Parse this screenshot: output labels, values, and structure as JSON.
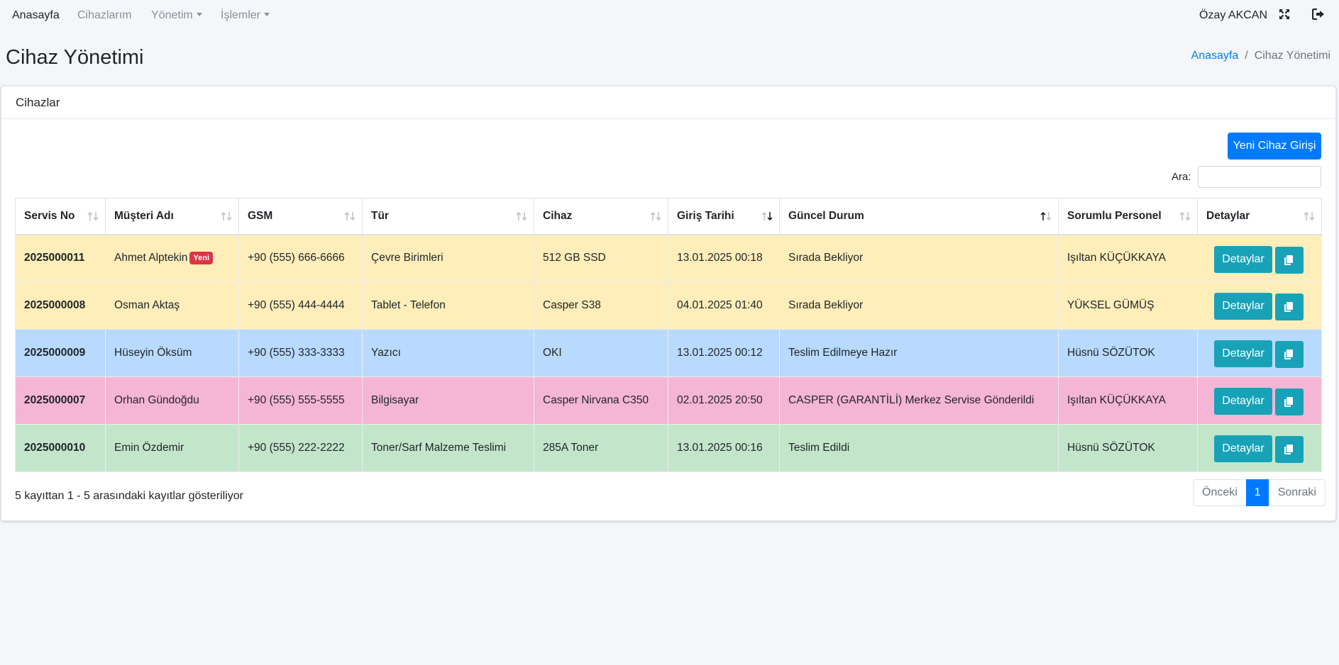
{
  "nav": {
    "home": "Anasayfa",
    "devices": "Cihazlarım",
    "management": "Yönetim",
    "operations": "İşlemler",
    "user": "Özay AKCAN"
  },
  "header": {
    "title": "Cihaz Yönetimi",
    "breadcrumb_home": "Anasayfa",
    "breadcrumb_current": "Cihaz Yönetimi"
  },
  "card": {
    "title": "Cihazlar",
    "new_button": "Yeni Cihaz Girişi",
    "search_label": "Ara:",
    "search_value": ""
  },
  "table": {
    "columns": [
      "Servis No",
      "Müşteri Adı",
      "GSM",
      "Tür",
      "Cihaz",
      "Giriş Tarihi",
      "Güncel Durum",
      "Sorumlu Personel",
      "Detaylar"
    ],
    "detail_label": "Detaylar",
    "new_badge": "Yeni",
    "rows": [
      {
        "status_class": "warning",
        "service_no": "2025000011",
        "customer": "Ahmet Alptekin",
        "is_new": true,
        "gsm": "+90 (555) 666-6666",
        "type": "Çevre Birimleri",
        "device": "512 GB SSD",
        "date": "13.01.2025 00:18",
        "status": "Sırada Bekliyor",
        "staff": "Işıltan KÜÇÜKKAYA"
      },
      {
        "status_class": "warning",
        "service_no": "2025000008",
        "customer": "Osman Aktaş",
        "is_new": false,
        "gsm": "+90 (555) 444-4444",
        "type": "Tablet - Telefon",
        "device": "Casper S38",
        "date": "04.01.2025 01:40",
        "status": "Sırada Bekliyor",
        "staff": "YÜKSEL GÜMÜŞ"
      },
      {
        "status_class": "info",
        "service_no": "2025000009",
        "customer": "Hüseyin Öksüm",
        "is_new": false,
        "gsm": "+90 (555) 333-3333",
        "type": "Yazıcı",
        "device": "OKI",
        "date": "13.01.2025 00:12",
        "status": "Teslim Edilmeye Hazır",
        "staff": "Hüsnü SÖZÜTOK"
      },
      {
        "status_class": "pink",
        "service_no": "2025000007",
        "customer": "Orhan Gündoğdu",
        "is_new": false,
        "gsm": "+90 (555) 555-5555",
        "type": "Bilgisayar",
        "device": "Casper Nirvana C350",
        "date": "02.01.2025 20:50",
        "status": "CASPER (GARANTİLİ) Merkez Servise Gönderildi",
        "staff": "Işıltan KÜÇÜKKAYA"
      },
      {
        "status_class": "success",
        "service_no": "2025000010",
        "customer": "Emin Özdemir",
        "is_new": false,
        "gsm": "+90 (555) 222-2222",
        "type": "Toner/Sarf Malzeme Teslimi",
        "device": "285A Toner",
        "date": "13.01.2025 00:16",
        "status": "Teslim Edildi",
        "staff": "Hüsnü SÖZÜTOK"
      }
    ]
  },
  "footer": {
    "info": "5 kayıttan 1 - 5 arasındaki kayıtlar gösteriliyor",
    "prev": "Önceki",
    "page": "1",
    "next": "Sonraki"
  },
  "colors": {
    "primary": "#007bff",
    "info": "#17a2b8",
    "danger": "#dc3545",
    "row_warning": "#ffeeba",
    "row_info": "#b8daff",
    "row_pink": "#f5b5d4",
    "row_success": "#c3e6cb"
  }
}
